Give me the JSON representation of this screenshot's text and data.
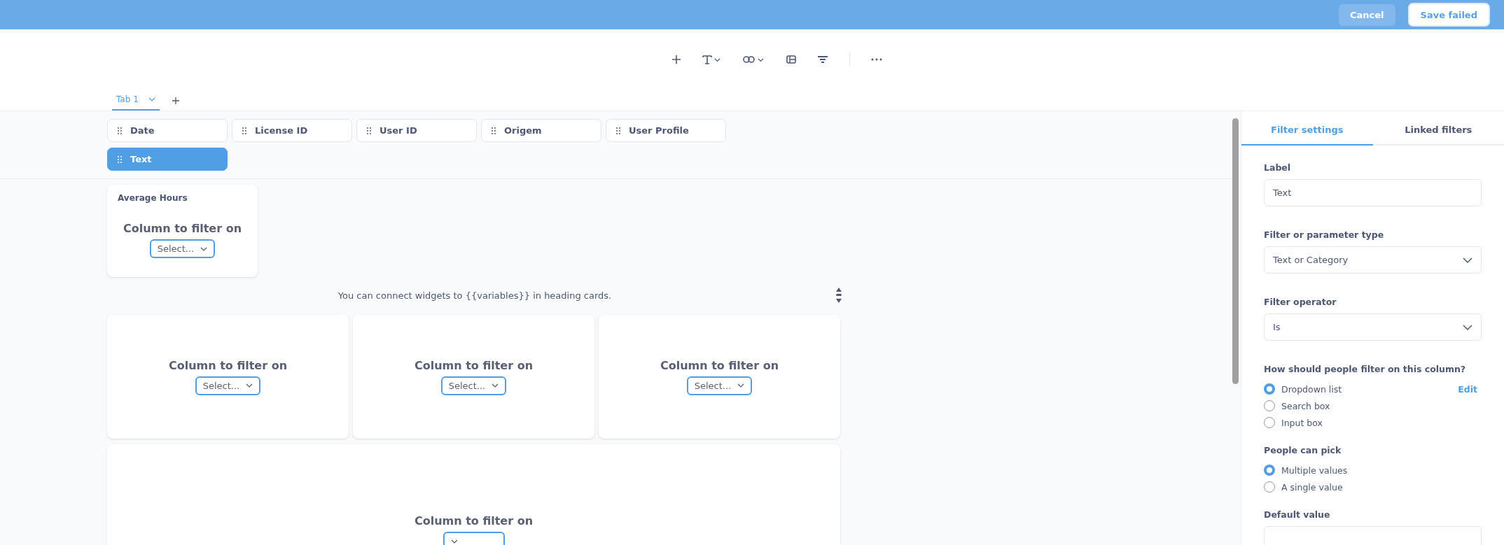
{
  "top_bar": {
    "cancel": "Cancel",
    "save": "Save failed"
  },
  "tabs": [
    {
      "label": "Tab 1",
      "selected": true
    }
  ],
  "filters": [
    {
      "label": "Date",
      "selected": false
    },
    {
      "label": "License ID",
      "selected": false
    },
    {
      "label": "User ID",
      "selected": false
    },
    {
      "label": "Origem",
      "selected": false
    },
    {
      "label": "User Profile",
      "selected": false
    },
    {
      "label": "Text",
      "selected": true
    }
  ],
  "heading_card": {
    "title": "Average Hours",
    "prompt": "Column to filter on",
    "select": "Select..."
  },
  "hint": "You can connect widgets to {{variables}} in heading cards.",
  "cards": [
    {
      "kind": "small",
      "prompt": "Column to filter on",
      "select": "Select..."
    },
    {
      "kind": "small",
      "prompt": "Column to filter on",
      "select": "Select..."
    },
    {
      "kind": "small",
      "prompt": "Column to filter on",
      "select": "Select..."
    },
    {
      "kind": "wide",
      "prompt": "Column to filter on"
    }
  ],
  "panel": {
    "tabs": [
      {
        "label": "Filter settings",
        "selected": true
      },
      {
        "label": "Linked filters",
        "selected": false
      }
    ],
    "label_field": {
      "label": "Label",
      "value": "Text"
    },
    "type_field": {
      "label": "Filter or parameter type",
      "value": "Text or Category"
    },
    "operator_field": {
      "label": "Filter operator",
      "value": "Is"
    },
    "filter_method": {
      "label": "How should people filter on this column?",
      "edit": "Edit",
      "options": [
        {
          "label": "Dropdown list",
          "selected": true
        },
        {
          "label": "Search box",
          "selected": false
        },
        {
          "label": "Input box",
          "selected": false
        }
      ]
    },
    "pick": {
      "label": "People can pick",
      "options": [
        {
          "label": "Multiple values",
          "selected": true
        },
        {
          "label": "A single value",
          "selected": false
        }
      ]
    },
    "default_value": {
      "label": "Default value"
    }
  }
}
